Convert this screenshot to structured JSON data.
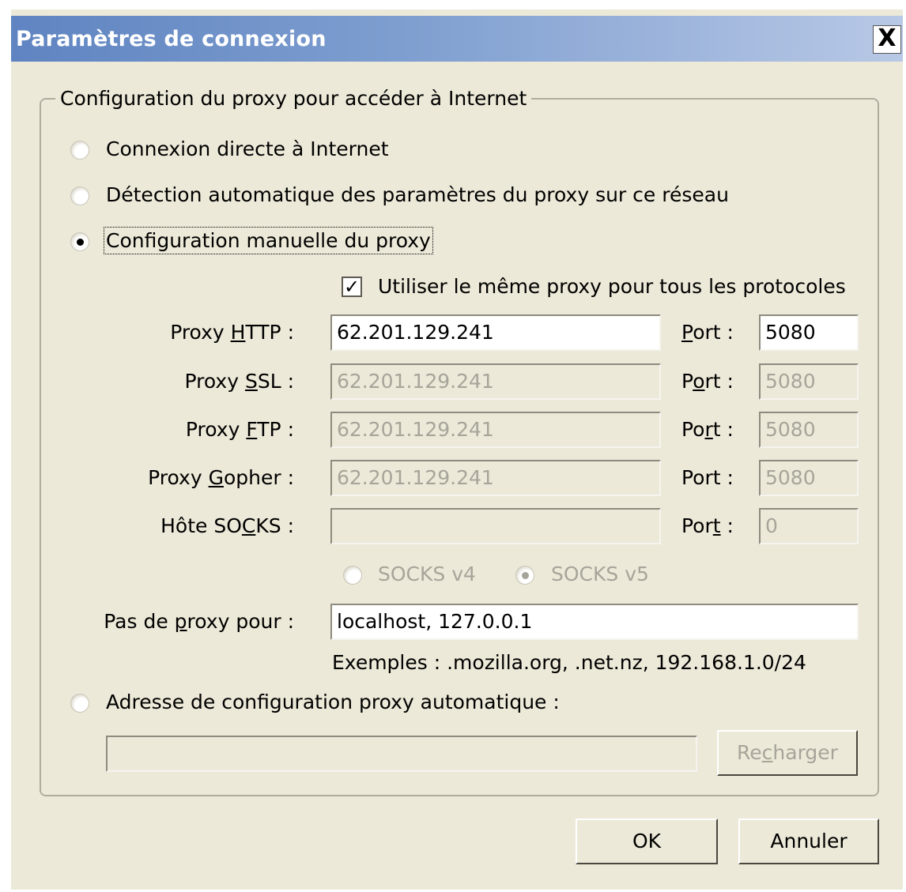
{
  "window": {
    "title": "Paramètres de connexion",
    "close_label": "X"
  },
  "group": {
    "legend": "Configuration du proxy pour accéder à Internet"
  },
  "options": {
    "direct": "Connexion directe à Internet",
    "auto_detect": "Détection automatique des paramètres du proxy sur ce réseau",
    "manual": "Configuration manuelle du proxy",
    "auto_config_url": "Adresse de configuration proxy automatique :",
    "selected": "manual"
  },
  "same_proxy": {
    "label": "Utiliser le même proxy pour tous les protocoles",
    "checked": true
  },
  "proxies": {
    "http": {
      "label_pre": "Proxy ",
      "label_ul": "H",
      "label_post": "TTP :",
      "value": "62.201.129.241",
      "port_pre": "",
      "port_ul": "P",
      "port_post": "ort :",
      "port": "5080"
    },
    "ssl": {
      "label_pre": "Proxy ",
      "label_ul": "S",
      "label_post": "SL :",
      "value": "62.201.129.241",
      "port_pre": "P",
      "port_ul": "o",
      "port_post": "rt :",
      "port": "5080"
    },
    "ftp": {
      "label_pre": "Proxy ",
      "label_ul": "F",
      "label_post": "TP :",
      "value": "62.201.129.241",
      "port_pre": "Po",
      "port_ul": "r",
      "port_post": "t :",
      "port": "5080"
    },
    "gopher": {
      "label_pre": "Proxy ",
      "label_ul": "G",
      "label_post": "opher :",
      "value": "62.201.129.241",
      "port_pre": "Port :",
      "port_ul": "",
      "port_post": "",
      "port": "5080"
    },
    "socks": {
      "label_pre": "Hôte SO",
      "label_ul": "C",
      "label_post": "KS :",
      "value": "",
      "port_pre": "Por",
      "port_ul": "t",
      "port_post": " :",
      "port": "0"
    }
  },
  "socks_version": {
    "v4": "SOCKS v4",
    "v5": "SOCKS v5",
    "selected": "v5"
  },
  "no_proxy": {
    "label_pre": "Pas de ",
    "label_ul": "p",
    "label_post": "roxy pour :",
    "value": "localhost, 127.0.0.1",
    "examples": "Exemples : .mozilla.org, .net.nz, 192.168.1.0/24"
  },
  "auto_config": {
    "url": "",
    "reload_pre": "Re",
    "reload_ul": "c",
    "reload_post": "harger"
  },
  "buttons": {
    "ok": "OK",
    "cancel": "Annuler"
  }
}
